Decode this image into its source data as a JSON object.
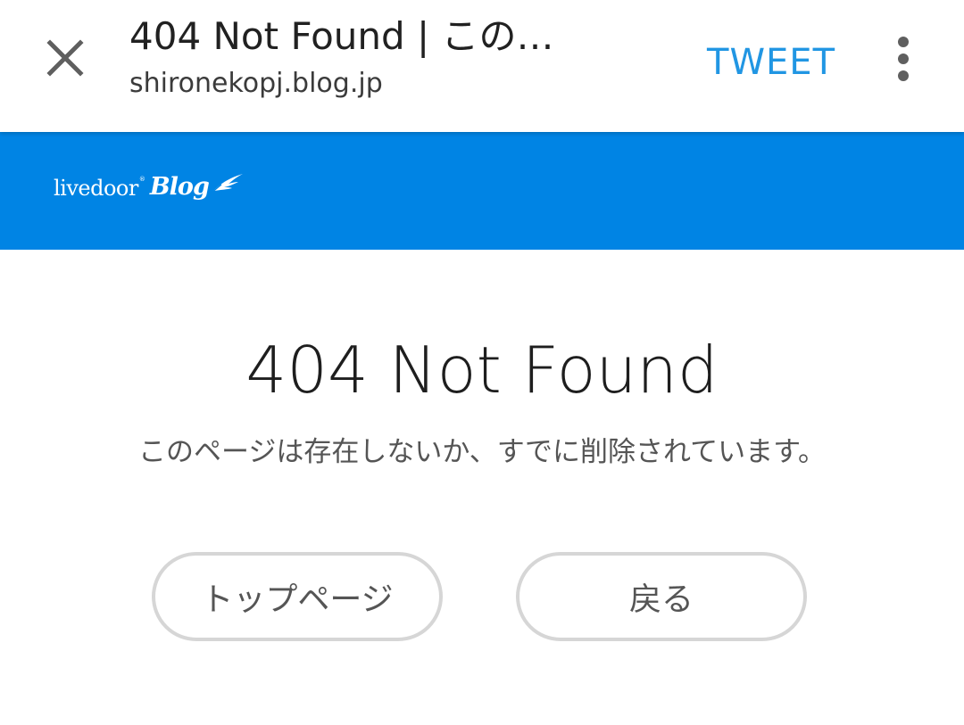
{
  "browser": {
    "page_title": "404 Not Found | この…",
    "url": "shironekopj.blog.jp",
    "tweet_label": "TWEET",
    "close_icon": "close-icon",
    "more_icon": "more-vert-icon"
  },
  "site_header": {
    "logo_text_livedoor": "livedoor",
    "logo_reg": "®",
    "logo_text_blog": "Blog",
    "brand_color": "#0084e4"
  },
  "main": {
    "error_title": "404 Not Found",
    "error_message": "このページは存在しないか、すでに削除されています。",
    "top_page_button": "トップページ",
    "back_button": "戻る"
  },
  "colors": {
    "accent_tweet": "#2196e3",
    "button_border": "#d6d6d6"
  }
}
